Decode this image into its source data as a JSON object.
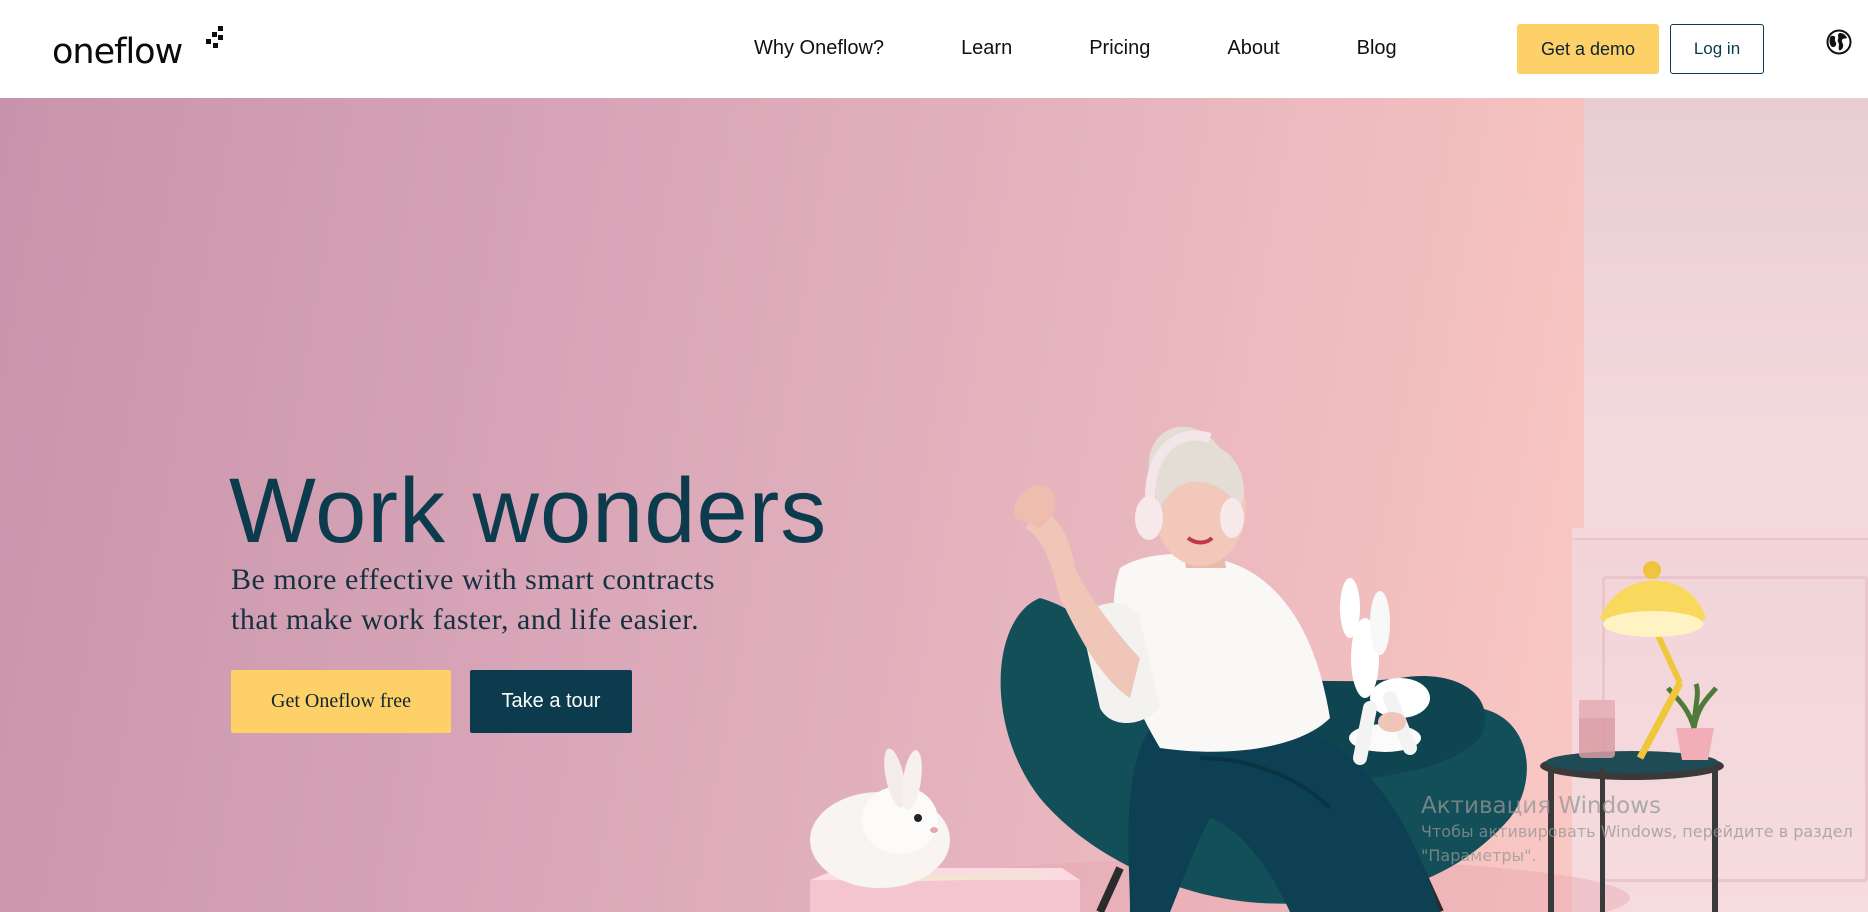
{
  "header": {
    "logo_text": "oneflow",
    "nav": [
      {
        "label": "Why Oneflow?"
      },
      {
        "label": "Learn"
      },
      {
        "label": "Pricing"
      },
      {
        "label": "About"
      },
      {
        "label": "Blog"
      }
    ],
    "demo_label": "Get a demo",
    "login_label": "Log in",
    "language_icon": "globe-icon"
  },
  "hero": {
    "title": "Work wonders",
    "subtitle_line1": "Be more effective with smart contracts",
    "subtitle_line2": "that make work faster, and life easier.",
    "primary_cta": "Get Oneflow free",
    "secondary_cta": "Take a tour"
  },
  "watermark": {
    "title": "Активация Windows",
    "line1": "Чтобы активировать Windows, перейдите в раздел",
    "line2": "\"Параметры\"."
  },
  "colors": {
    "brand_yellow": "#fdd167",
    "brand_navy": "#0d3b4e",
    "hero_pink": "#d9a7b8"
  }
}
